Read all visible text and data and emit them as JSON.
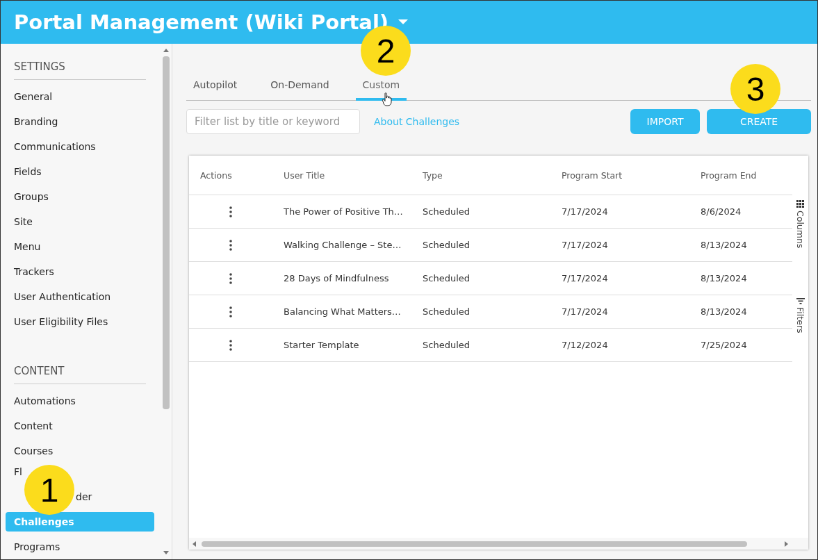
{
  "header": {
    "title": "Portal Management (Wiki Portal)"
  },
  "sidebar": {
    "sections": [
      {
        "heading": "SETTINGS",
        "items": [
          {
            "label": "General",
            "selected": false
          },
          {
            "label": "Branding",
            "selected": false
          },
          {
            "label": "Communications",
            "selected": false
          },
          {
            "label": "Fields",
            "selected": false
          },
          {
            "label": "Groups",
            "selected": false
          },
          {
            "label": "Site",
            "selected": false
          },
          {
            "label": "Menu",
            "selected": false
          },
          {
            "label": "Trackers",
            "selected": false
          },
          {
            "label": "User Authentication",
            "selected": false
          },
          {
            "label": "User Eligibility Files",
            "selected": false
          }
        ]
      },
      {
        "heading": "CONTENT",
        "items": [
          {
            "label": "Automations",
            "selected": false
          },
          {
            "label": "Content",
            "selected": false
          },
          {
            "label": "Courses",
            "selected": false
          },
          {
            "label": "Fl",
            "selected": false,
            "kind": "covered_end"
          },
          {
            "label": "der",
            "selected": false,
            "kind": "covered_start"
          },
          {
            "label": "Challenges",
            "selected": true
          },
          {
            "label": "Programs",
            "selected": false
          }
        ]
      }
    ]
  },
  "tabs": [
    {
      "label": "Autopilot",
      "selected": false
    },
    {
      "label": "On-Demand",
      "selected": false
    },
    {
      "label": "Custom",
      "selected": true
    }
  ],
  "search": {
    "placeholder": "Filter list by title or keyword"
  },
  "link": "About Challenges",
  "buttons": [
    "IMPORT",
    "CREATE"
  ],
  "table": {
    "columns": [
      "Actions",
      "User Title",
      "Type",
      "Program Start",
      "Program End"
    ],
    "rows": [
      [
        "",
        "The Power of Positive Th…",
        "Scheduled",
        "7/17/2024",
        "8/6/2024"
      ],
      [
        "",
        "Walking Challenge – Ste…",
        "Scheduled",
        "7/17/2024",
        "8/13/2024"
      ],
      [
        "",
        "28 Days of Mindfulness",
        "Scheduled",
        "7/17/2024",
        "8/13/2024"
      ],
      [
        "",
        "Balancing What Matters…",
        "Scheduled",
        "7/17/2024",
        "8/13/2024"
      ],
      [
        "",
        "Starter Template",
        "Scheduled",
        "7/12/2024",
        "7/25/2024"
      ]
    ],
    "side_tabs": [
      "Columns",
      "Filters"
    ]
  },
  "callouts": [
    "1",
    "2",
    "3"
  ]
}
